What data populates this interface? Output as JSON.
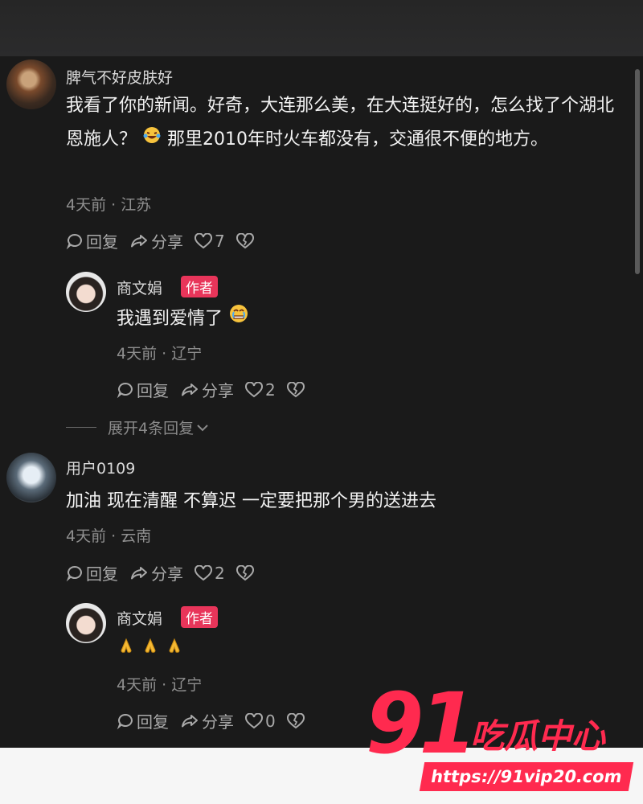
{
  "comments": [
    {
      "user": "脾气不好皮肤好",
      "text": "我看了你的新闻。好奇，大连那么美，在大连挺好的，怎么找了个湖北恩施人？",
      "text_after_emoji": "那里2010年时火车都没有，交通很不便的地方。",
      "meta": "4天前 · 江苏",
      "reply_label": "回复",
      "share_label": "分享",
      "likes": "7",
      "reply": {
        "user": "商文娟",
        "badge": "作者",
        "text": "我遇到爱情了",
        "meta": "4天前 · 辽宁",
        "reply_label": "回复",
        "share_label": "分享",
        "likes": "2"
      },
      "expand_label": "展开4条回复"
    },
    {
      "user": "用户0109",
      "text": "加油 现在清醒 不算迟 一定要把那个男的送进去",
      "meta": "4天前 · 云南",
      "reply_label": "回复",
      "share_label": "分享",
      "likes": "2",
      "reply": {
        "user": "商文娟",
        "badge": "作者",
        "text": "",
        "meta": "4天前 · 辽宁",
        "reply_label": "回复",
        "share_label": "分享",
        "likes": "0"
      }
    }
  ],
  "watermark": {
    "number": "91",
    "name": "吃瓜中心",
    "url": "https://91vip20.com"
  },
  "icons": [
    "reply-icon",
    "share-icon",
    "heart-icon",
    "broken-heart-icon",
    "chevron-down-icon",
    "laughing-crying-emoji",
    "teary-emoji",
    "praying-hands-emoji"
  ],
  "colors": {
    "badge": "#e8355a",
    "watermark": "#ff2a4f",
    "background": "#1a1a1a"
  }
}
